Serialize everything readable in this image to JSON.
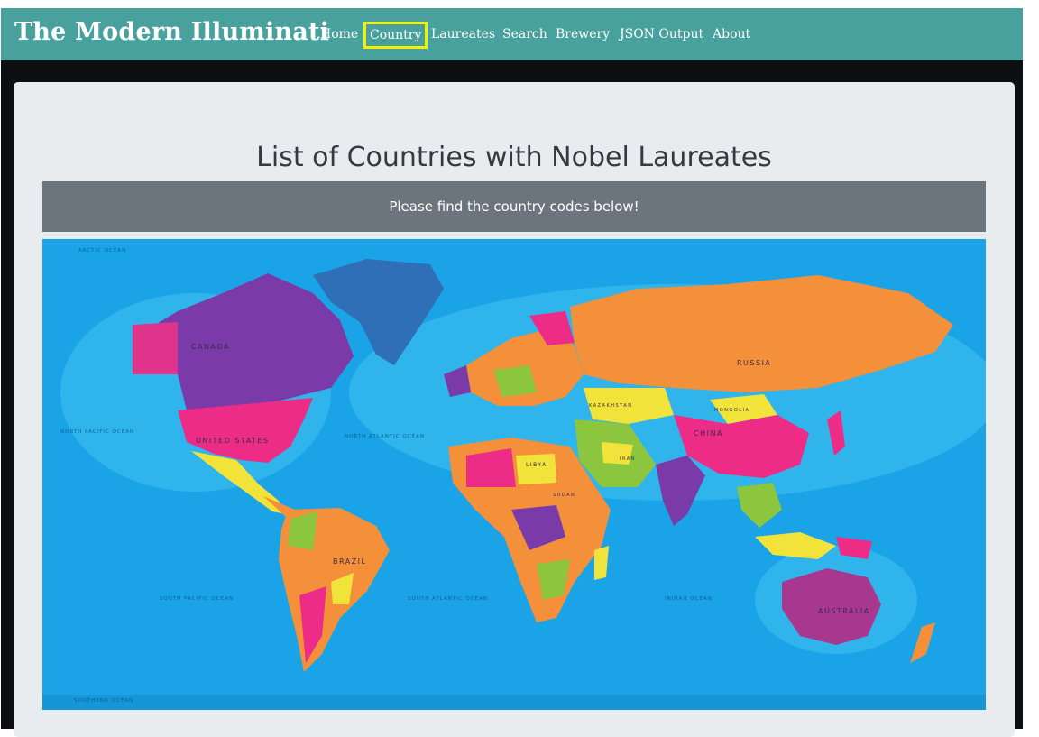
{
  "navbar": {
    "brand": "The Modern Illuminati",
    "items": [
      {
        "label": "Home",
        "active": false
      },
      {
        "label": "Country",
        "active": true
      },
      {
        "label": "Laureates",
        "active": false
      },
      {
        "label": "Search",
        "active": false
      },
      {
        "label": "Brewery",
        "active": false
      },
      {
        "label": "JSON Output",
        "active": false
      },
      {
        "label": "About",
        "active": false
      }
    ],
    "active_highlight_color": "#f3f000"
  },
  "main": {
    "title": "List of Countries with Nobel Laureates",
    "banner_text": "Please find the country codes below!"
  },
  "map": {
    "labels": {
      "canada": "CANADA",
      "united_states": "UNITED STATES",
      "brazil": "BRAZIL",
      "russia": "RUSSIA",
      "china": "CHINA",
      "australia": "AUSTRALIA",
      "libya": "LIBYA",
      "mongolia": "MONGOLIA",
      "kazakhstan": "KAZAKHSTAN",
      "iran": "IRAN",
      "sudan": "SUDAN",
      "north_pacific": "NORTH PACIFIC OCEAN",
      "north_atlantic": "NORTH ATLANTIC OCEAN",
      "south_pacific": "SOUTH PACIFIC OCEAN",
      "south_atlantic": "SOUTH ATLANTIC OCEAN",
      "indian_ocean": "INDIAN OCEAN",
      "arctic_ocean": "ARCTIC OCEAN",
      "southern_ocean": "SOUTHERN OCEAN"
    }
  },
  "colors": {
    "navbar": "#48a19d",
    "banner": "#6c757d",
    "ocean": "#1aa3e6"
  }
}
